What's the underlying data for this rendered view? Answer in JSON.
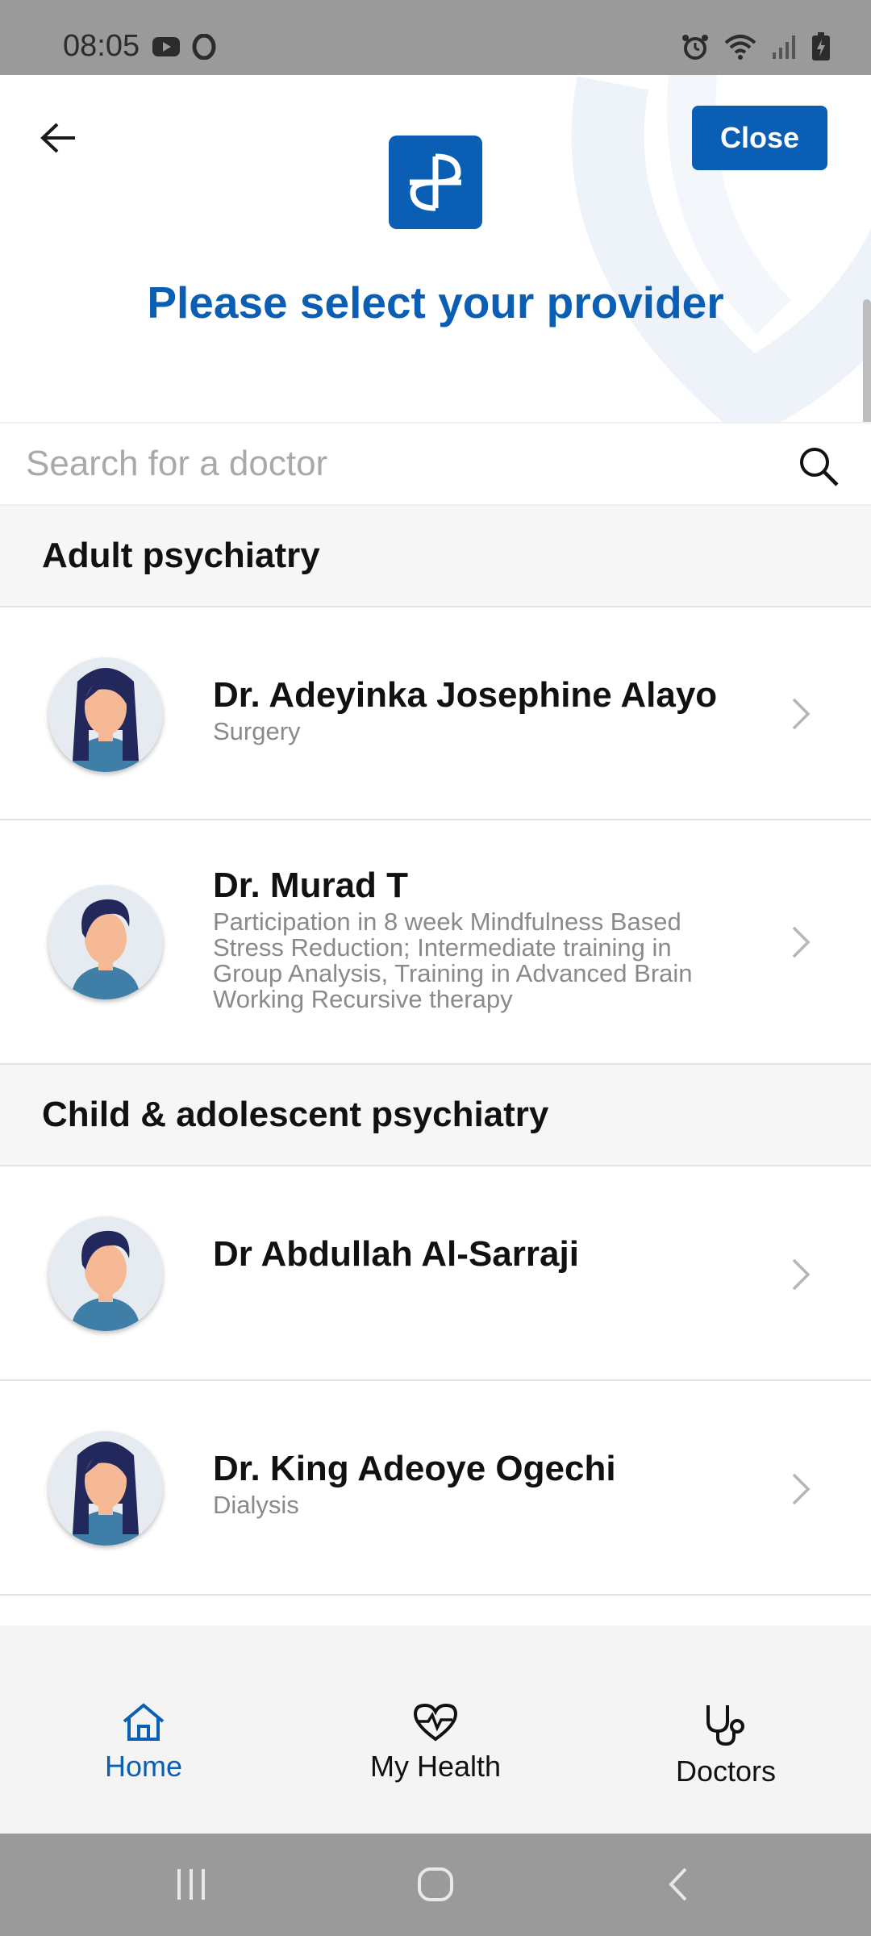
{
  "status_bar": {
    "time": "08:05",
    "left_icons": [
      "youtube-icon",
      "opera-icon"
    ],
    "right_icons": [
      "alarm-icon",
      "wifi-icon",
      "signal-icon",
      "battery-charging-icon"
    ]
  },
  "header": {
    "back_icon": "arrow-left-icon",
    "close_label": "Close",
    "title": "Please select your provider",
    "logo_icon": "app-logo-icon"
  },
  "search": {
    "placeholder": "Search for a doctor",
    "value": "",
    "icon": "search-icon"
  },
  "sections": [
    {
      "title": "Adult psychiatry",
      "doctors": [
        {
          "name": "Dr. Adeyinka Josephine Alayo",
          "subtitle": "Surgery",
          "avatar": "female-doctor-avatar"
        },
        {
          "name": "Dr. Murad T",
          "subtitle": "Participation in 8 week Mindfulness Based Stress Reduction; Intermediate training in Group Analysis, Training in Advanced Brain Working Recursive therapy",
          "avatar": "male-doctor-avatar"
        }
      ]
    },
    {
      "title": "Child & adolescent psychiatry",
      "doctors": [
        {
          "name": "Dr Abdullah Al-Sarraji",
          "subtitle": "",
          "avatar": "male-doctor-avatar"
        },
        {
          "name": "Dr. King Adeoye Ogechi",
          "subtitle": "Dialysis",
          "avatar": "female-doctor-avatar"
        }
      ]
    }
  ],
  "bottom_nav": {
    "items": [
      {
        "label": "Home",
        "icon": "home-icon",
        "active": true
      },
      {
        "label": "My Health",
        "icon": "heart-pulse-icon",
        "active": false
      },
      {
        "label": "Doctors",
        "icon": "stethoscope-icon",
        "active": false
      }
    ]
  },
  "colors": {
    "accent": "#0a5fb5",
    "section_bg": "#f6f6f6",
    "nav_bg": "#f4f4f4",
    "system_bar": "#9a9a9a"
  }
}
